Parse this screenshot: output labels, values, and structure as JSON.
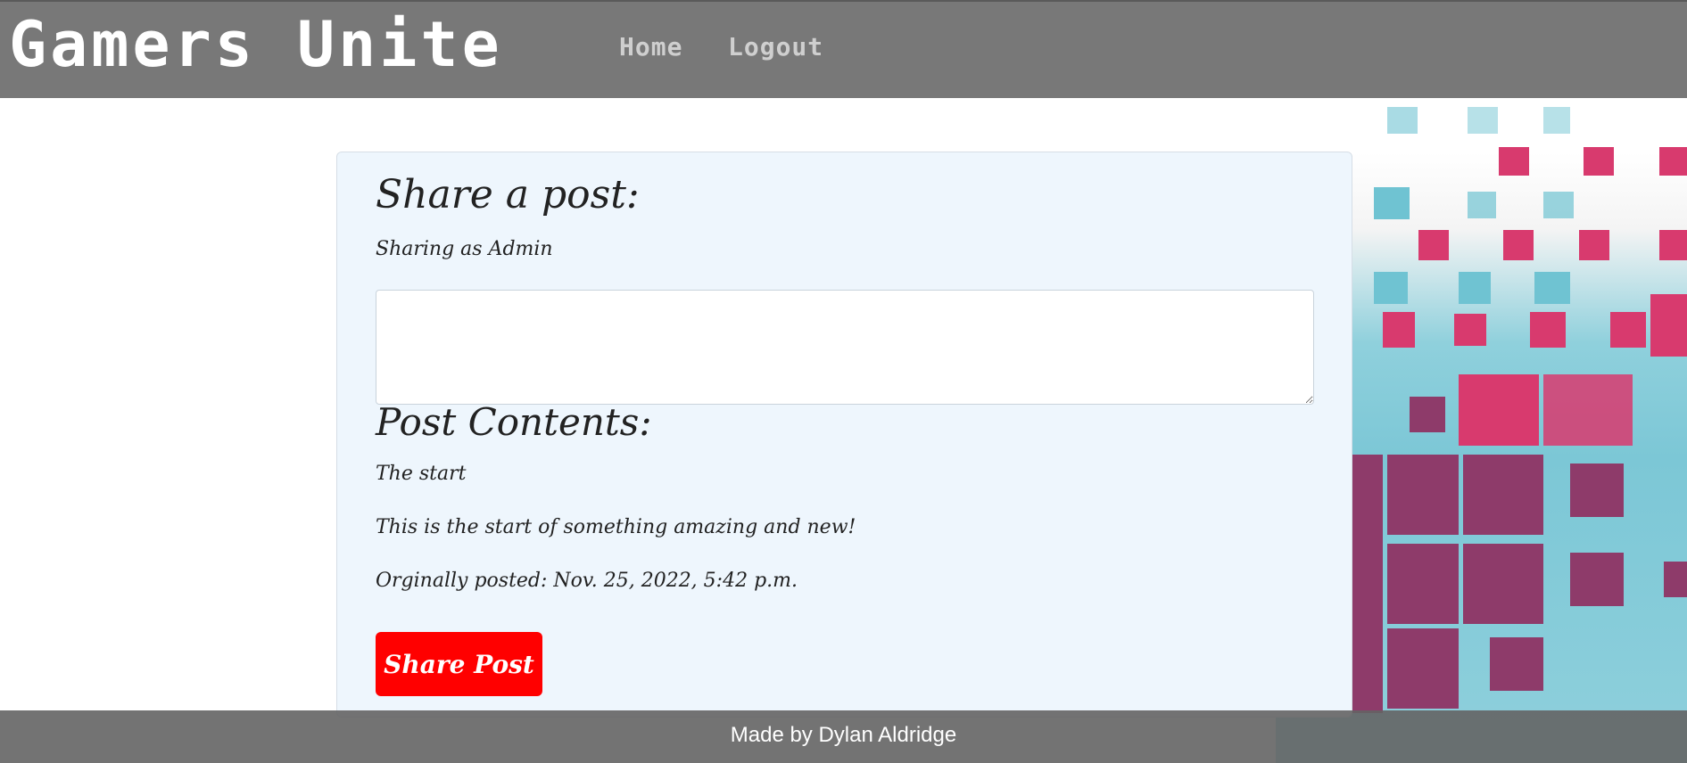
{
  "navbar": {
    "brand": "Gamers Unite",
    "links": [
      {
        "label": "Home"
      },
      {
        "label": "Logout"
      }
    ]
  },
  "card": {
    "title": "Share a post:",
    "sharing_as": "Sharing as Admin",
    "input": {
      "value": "",
      "placeholder": ""
    },
    "contents_title": "Post Contents:",
    "post_title": "The start",
    "post_body": "This is the start of something amazing and new!",
    "posted_on": "Orginally posted: Nov. 25, 2022, 5:42 p.m.",
    "submit_label": "Share Post"
  },
  "footer": {
    "text": "Made by Dylan Aldridge"
  },
  "colors": {
    "navbar_bg": "#6e6e6e",
    "card_bg": "#eef6fd",
    "button_bg": "#ff0000",
    "art_pink": "#d83a6e",
    "art_plum": "#8e3b6a",
    "art_teal": "#6fc3d2"
  }
}
